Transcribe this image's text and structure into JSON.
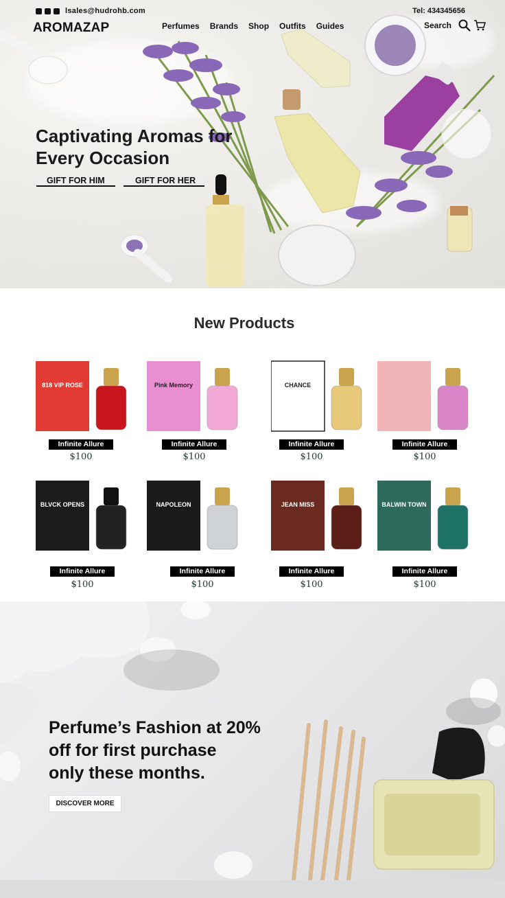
{
  "header": {
    "email": "lsales@hudrohb.com",
    "tel": "Tel: 434345656",
    "logo": "AROMAZAP",
    "nav": [
      "Perfumes",
      "Brands",
      "Shop",
      "Outfits",
      "Guides"
    ],
    "search_label": "Search"
  },
  "hero": {
    "headline_line1": "Captivating Aromas for",
    "headline_line2": "Every Occasion",
    "gift_him": "GIFT FOR HIM",
    "gift_her": "GIFT FOR HER"
  },
  "products": {
    "title": "New Products",
    "items": [
      {
        "name": "Infinite Allure",
        "price": "$100",
        "box_color": "#e23b34",
        "bottle_color": "#c8161c",
        "box_text": "818 VIP ROSE"
      },
      {
        "name": "Infinite Allure",
        "price": "$100",
        "box_color": "#e98ed0",
        "bottle_color": "#f2a9d6",
        "box_text": "Pink Memory"
      },
      {
        "name": "Infinite Allure",
        "price": "$100",
        "box_color": "#ffffff",
        "bottle_color": "#e8c97a",
        "box_text": "CHANCE"
      },
      {
        "name": "Infinite Allure",
        "price": "$100",
        "box_color": "#f1b5b8",
        "bottle_color": "#d986c9",
        "box_text": ""
      },
      {
        "name": "Infinite Allure",
        "price": "$100",
        "box_color": "#1c1c1c",
        "bottle_color": "#222222",
        "box_text": "BLVCK OPENS"
      },
      {
        "name": "Infinite Allure",
        "price": "$100",
        "box_color": "#1a1a1a",
        "bottle_color": "#cfd3d6",
        "box_text": "NAPOLEON"
      },
      {
        "name": "Infinite Allure",
        "price": "$100",
        "box_color": "#6b2a1f",
        "bottle_color": "#5c1f18",
        "box_text": "JEAN MISS"
      },
      {
        "name": "Infinite Allure",
        "price": "$100",
        "box_color": "#2e6a5c",
        "bottle_color": "#1f7366",
        "box_text": "BALWIN TOWN"
      }
    ]
  },
  "promo": {
    "line1": "Perfume’s Fashion at 20%",
    "line2": "off for first purchase",
    "line3": "only these months.",
    "button": "DISCOVER MORE"
  }
}
